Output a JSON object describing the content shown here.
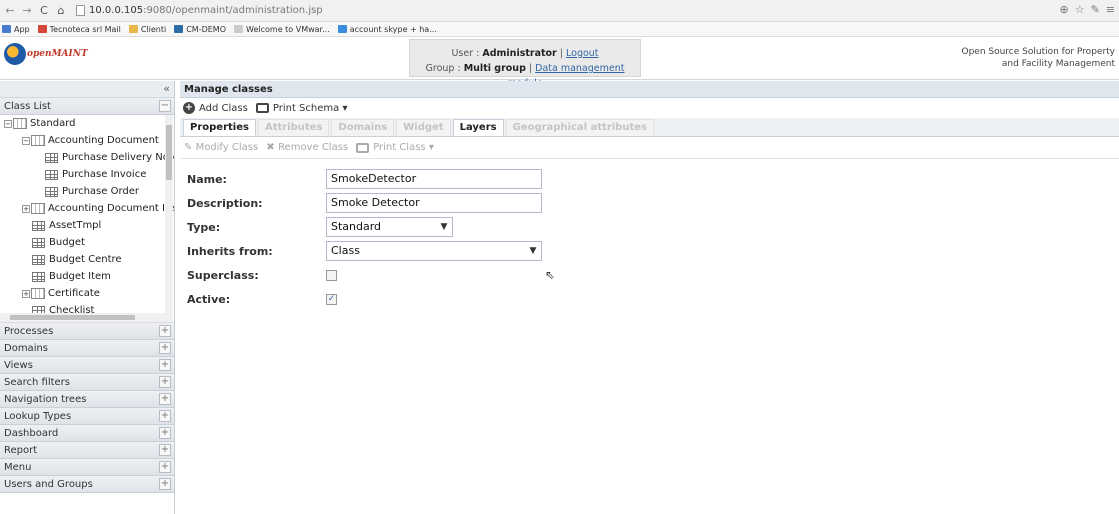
{
  "browser": {
    "url_host": "10.0.0.105",
    "url_path": ":9080/openmaint/administration.jsp",
    "bookmarks": [
      {
        "label": "App",
        "color": "#4a7bd0"
      },
      {
        "label": "Tecnoteca srl Mail",
        "color": "#d44638"
      },
      {
        "label": "Clienti",
        "color": "#e8b84a"
      },
      {
        "label": "CM-DEMO",
        "color": "#2e6da4"
      },
      {
        "label": "Welcome to VMwar...",
        "color": "#cccccc"
      },
      {
        "label": "account skype + ha...",
        "color": "#3b8de0"
      }
    ]
  },
  "header": {
    "logo_text": "openMAINT",
    "user_label": "User :",
    "user_name": "Administrator",
    "logout": "Logout",
    "group_label": "Group :",
    "group_name": "Multi group",
    "module_link": "Data management module",
    "tagline": "Open Source Solution for Property and Facility Management"
  },
  "sidebar": {
    "class_list_title": "Class List",
    "tree": [
      {
        "label": "Standard",
        "level": 0,
        "type": "folder",
        "expander": "−"
      },
      {
        "label": "Accounting Document",
        "level": 1,
        "type": "folder",
        "expander": "−"
      },
      {
        "label": "Purchase Delivery Note",
        "level": 2,
        "type": "table",
        "expander": ""
      },
      {
        "label": "Purchase Invoice",
        "level": 2,
        "type": "table",
        "expander": ""
      },
      {
        "label": "Purchase Order",
        "level": 2,
        "type": "table",
        "expander": ""
      },
      {
        "label": "Accounting Document Item",
        "level": 1,
        "type": "folder",
        "expander": "+"
      },
      {
        "label": "AssetTmpl",
        "level": 1,
        "type": "table",
        "expander": ""
      },
      {
        "label": "Budget",
        "level": 1,
        "type": "table",
        "expander": ""
      },
      {
        "label": "Budget Centre",
        "level": 1,
        "type": "table",
        "expander": ""
      },
      {
        "label": "Budget Item",
        "level": 1,
        "type": "table",
        "expander": ""
      },
      {
        "label": "Certificate",
        "level": 1,
        "type": "folder",
        "expander": "+"
      },
      {
        "label": "Checklist",
        "level": 1,
        "type": "table",
        "expander": ""
      }
    ],
    "sections": [
      "Processes",
      "Domains",
      "Views",
      "Search filters",
      "Navigation trees",
      "Lookup Types",
      "Dashboard",
      "Report",
      "Menu",
      "Users and Groups"
    ]
  },
  "main": {
    "title": "Manage classes",
    "add_class": "Add Class",
    "print_schema": "Print Schema",
    "tabs": [
      {
        "label": "Properties",
        "active": true
      },
      {
        "label": "Attributes",
        "active": false
      },
      {
        "label": "Domains",
        "active": false
      },
      {
        "label": "Widget",
        "active": false
      },
      {
        "label": "Layers",
        "active": true
      },
      {
        "label": "Geographical attributes",
        "active": false
      }
    ],
    "modify_class": "Modify Class",
    "remove_class": "Remove Class",
    "print_class": "Print Class",
    "form": {
      "name_label": "Name:",
      "name_value": "SmokeDetector",
      "description_label": "Description:",
      "description_value": "Smoke Detector",
      "type_label": "Type:",
      "type_value": "Standard",
      "inherits_label": "Inherits from:",
      "inherits_value": "Class",
      "superclass_label": "Superclass:",
      "superclass_checked": false,
      "active_label": "Active:",
      "active_checked": true
    }
  }
}
